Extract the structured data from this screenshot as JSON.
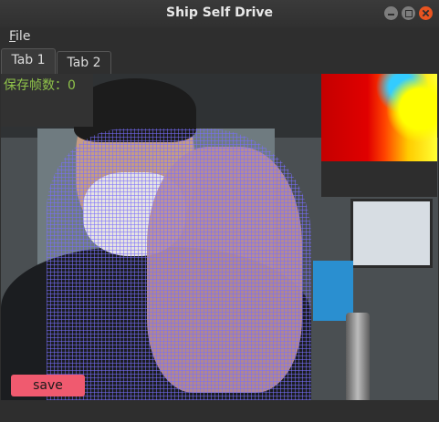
{
  "window": {
    "title": "Ship Self Drive"
  },
  "menu": {
    "file_mnemonic": "F",
    "file_rest": "ile"
  },
  "tabs": [
    {
      "label": "Tab 1",
      "active": true
    },
    {
      "label": "Tab 2",
      "active": false
    }
  ],
  "overlay": {
    "saved_frames_label": "保存帧数：",
    "saved_frames_count": "0"
  },
  "actions": {
    "save_label": "save"
  },
  "colors": {
    "accent_save": "#f05a6f",
    "counter_text": "#8fc24a",
    "close_button": "#e95420"
  }
}
